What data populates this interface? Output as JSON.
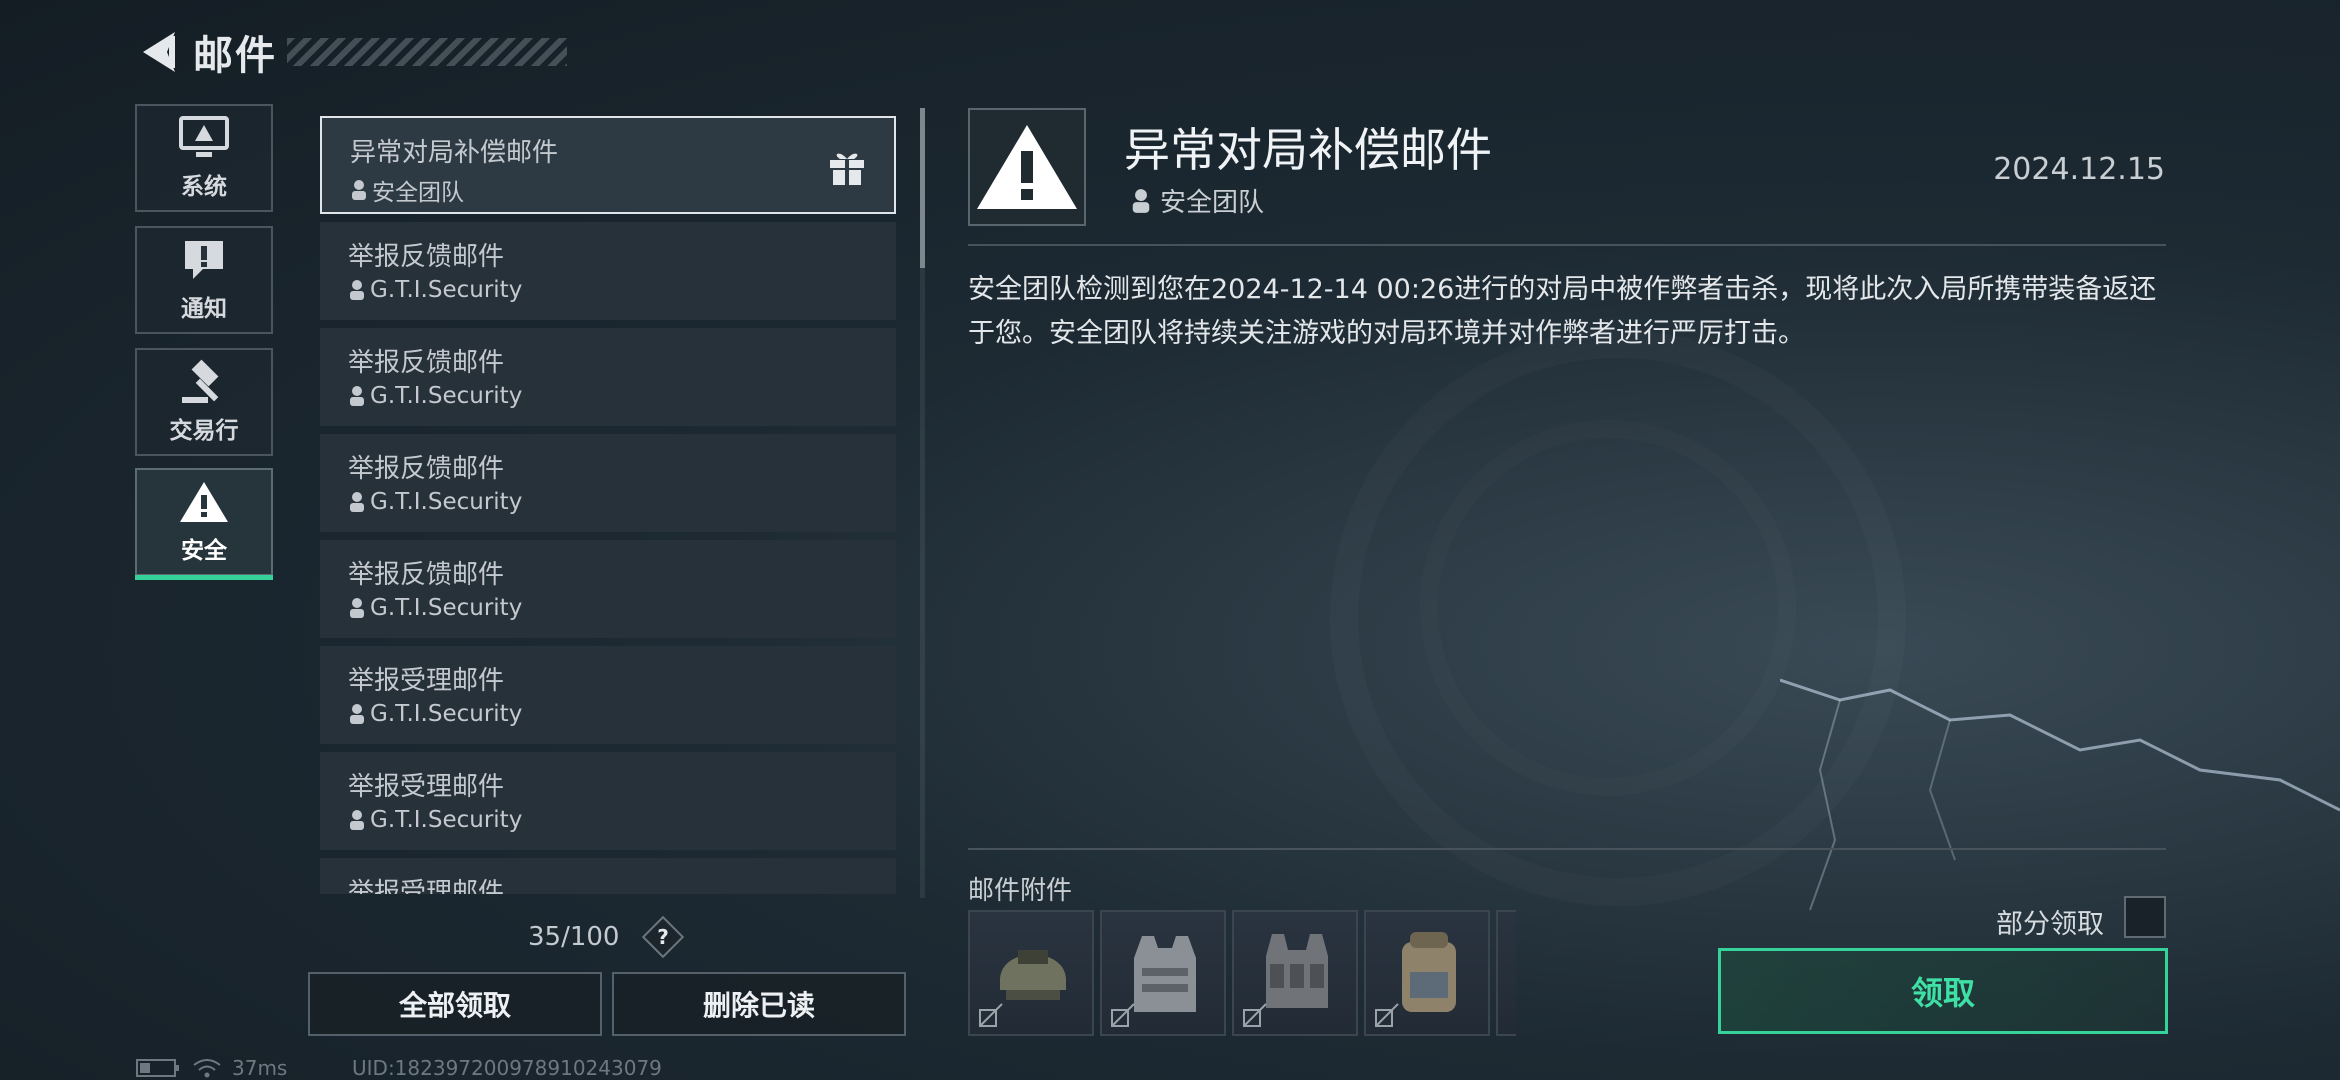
{
  "header": {
    "title": "邮件"
  },
  "categories": [
    {
      "label": "系统",
      "icon": "monitor-icon",
      "active": false
    },
    {
      "label": "通知",
      "icon": "exclamation-bubble-icon",
      "active": false
    },
    {
      "label": "交易行",
      "icon": "gavel-icon",
      "active": false
    },
    {
      "label": "安全",
      "icon": "warning-icon",
      "active": true
    }
  ],
  "mails": [
    {
      "subject": "异常对局补偿邮件",
      "sender": "安全团队",
      "selected": true,
      "has_gift": true
    },
    {
      "subject": "举报反馈邮件",
      "sender": "G.T.I.Security"
    },
    {
      "subject": "举报反馈邮件",
      "sender": "G.T.I.Security"
    },
    {
      "subject": "举报反馈邮件",
      "sender": "G.T.I.Security"
    },
    {
      "subject": "举报反馈邮件",
      "sender": "G.T.I.Security"
    },
    {
      "subject": "举报受理邮件",
      "sender": "G.T.I.Security"
    },
    {
      "subject": "举报受理邮件",
      "sender": "G.T.I.Security"
    },
    {
      "subject": "举报受理邮件",
      "sender": ""
    }
  ],
  "mail_count": "35/100",
  "help_label": "?",
  "buttons": {
    "claim_all": "全部领取",
    "delete_read": "删除已读"
  },
  "detail": {
    "title": "异常对局补偿邮件",
    "sender": "安全团队",
    "date": "2024.12.15",
    "body": "安全团队检测到您在2024-12-14 00:26进行的对局中被作弊者击杀，现将此次入局所携带装备返还于您。安全团队将持续关注游戏的对局环境并对作弊者进行严厉打击。",
    "attachments_label": "邮件附件",
    "attachments": [
      {
        "icon": "helmet-icon"
      },
      {
        "icon": "armor-vest-icon"
      },
      {
        "icon": "chest-rig-icon"
      },
      {
        "icon": "backpack-icon"
      },
      {
        "icon": "item-icon"
      }
    ],
    "partial_claim_label": "部分领取",
    "claim_label": "领取"
  },
  "status": {
    "ping": "37ms",
    "uid": "UID:18239720097891024307​9"
  },
  "colors": {
    "accent": "#35d29a",
    "claim_text": "#3fe0a5"
  }
}
